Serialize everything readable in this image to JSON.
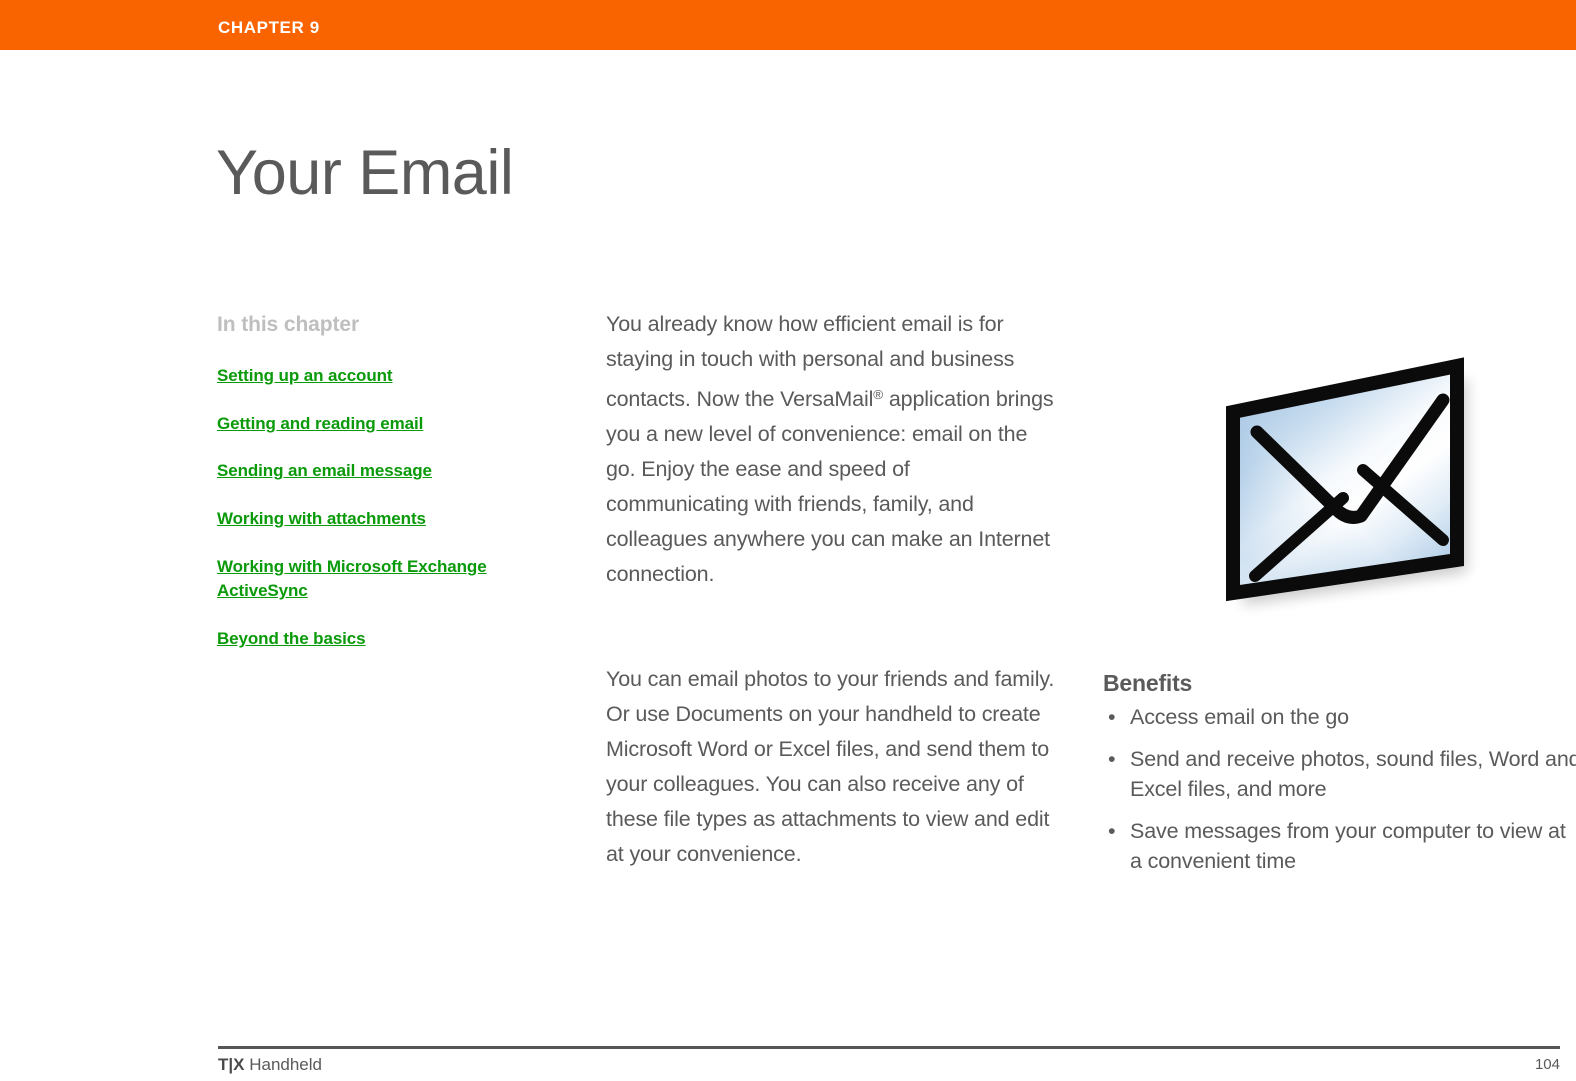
{
  "header": {
    "chapter_label": "CHAPTER 9",
    "bar_color": "#fa6400"
  },
  "page_title": "Your Email",
  "sidebar": {
    "heading": "In this chapter",
    "link_color": "#0a9a0a",
    "items": [
      {
        "label": "Setting up an account"
      },
      {
        "label": "Getting and reading email"
      },
      {
        "label": "Sending an email message"
      },
      {
        "label": "Working with attachments"
      },
      {
        "label": "Working with Microsoft Exchange ActiveSync"
      },
      {
        "label": "Beyond the basics"
      }
    ]
  },
  "body": {
    "paragraph_1_before_mark": "You already know how efficient email is for staying in touch with personal and business contacts. Now the VersaMail",
    "paragraph_1_mark": "®",
    "paragraph_1_after_mark": " application brings you a new level of convenience: email on the go. Enjoy the ease and speed of communicating with friends, family, and colleagues anywhere you can make an Internet connection.",
    "paragraph_2": "You can email photos to your friends and family. Or use Documents on your handheld to create Microsoft Word or Excel files, and send them to your colleagues. You can also receive any of these file types as attachments to view and edit at your convenience."
  },
  "illustration": {
    "name": "envelope-illustration",
    "fill_light": "#ffffff",
    "fill_blue": "#8fb8dd",
    "outline": "#0b0b0b"
  },
  "benefits": {
    "heading": "Benefits",
    "items": [
      {
        "bullet": "•",
        "text": "Access email on the go"
      },
      {
        "bullet": "•",
        "text": "Send and receive photos, sound files, Word and Excel files, and more"
      },
      {
        "bullet": "•",
        "text": "Save messages from your computer to view at a convenient time"
      }
    ]
  },
  "footer": {
    "brand": "T|X",
    "product": " Handheld",
    "page_number": "104"
  }
}
